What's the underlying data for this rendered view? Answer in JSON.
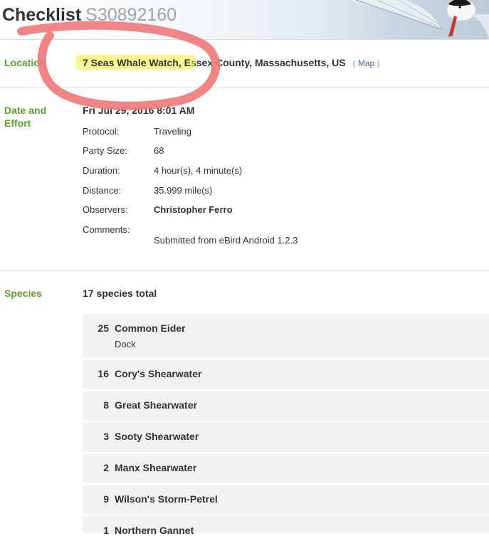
{
  "header": {
    "title_word": "Checklist",
    "checklist_id": "S30892160"
  },
  "location": {
    "label": "Location",
    "name_highlighted": "7 Seas Whale Watch, E",
    "name_rest": "ssex County, Massachusetts, US",
    "map_open": "(",
    "map_link": "Map",
    "map_close": ")"
  },
  "effort": {
    "label_line1": "Date and",
    "label_line2": "Effort",
    "datetime": "Fri Jul 29, 2016 8:01 AM",
    "rows": [
      {
        "key": "Protocol:",
        "value": "Traveling"
      },
      {
        "key": "Party Size:",
        "value": "68"
      },
      {
        "key": "Duration:",
        "value": "4 hour(s), 4 minute(s)"
      },
      {
        "key": "Distance:",
        "value": "35.999 mile(s)"
      },
      {
        "key": "Observers:",
        "value": "Christopher Ferro"
      },
      {
        "key": "Comments:",
        "value": ""
      }
    ],
    "comments": "Submitted from eBird Android 1.2.3"
  },
  "species": {
    "label": "Species",
    "total": "17 species total",
    "items": [
      {
        "count": "25",
        "name": "Common Eider",
        "note": "Dock"
      },
      {
        "count": "16",
        "name": "Cory's Shearwater",
        "note": ""
      },
      {
        "count": "8",
        "name": "Great Shearwater",
        "note": ""
      },
      {
        "count": "3",
        "name": "Sooty Shearwater",
        "note": ""
      },
      {
        "count": "2",
        "name": "Manx Shearwater",
        "note": ""
      },
      {
        "count": "9",
        "name": "Wilson's Storm-Petrel",
        "note": ""
      },
      {
        "count": "1",
        "name": "Northern Gannet",
        "note": ""
      }
    ]
  },
  "colors": {
    "label_green": "#5ba22f",
    "link_blue": "#3a6aa8",
    "highlight_yellow": "#f5f23a",
    "annotation_red": "#f07a7a",
    "row_bg": "#f2f2f2"
  }
}
